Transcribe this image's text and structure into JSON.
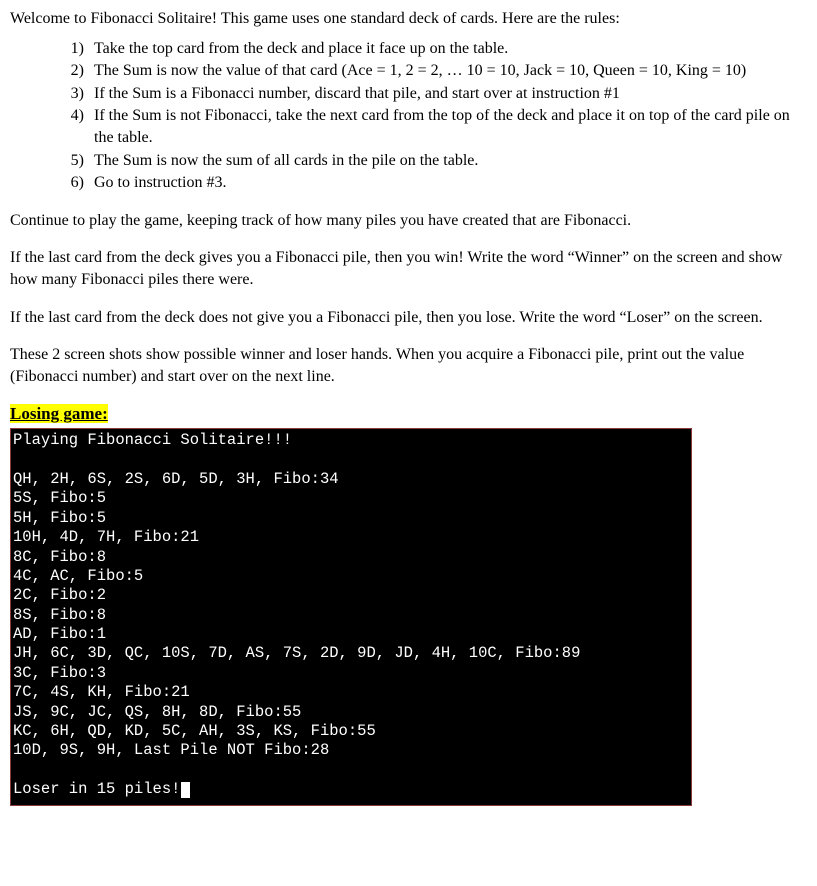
{
  "intro": "Welcome to Fibonacci Solitaire! This game uses one standard deck of cards. Here are the rules:",
  "rules": [
    {
      "n": "1)",
      "text": "Take the top card from the deck and place it face up on the table."
    },
    {
      "n": "2)",
      "text": "The Sum is now the value of that card (Ace = 1, 2 = 2, … 10 = 10, Jack = 10, Queen = 10, King = 10)"
    },
    {
      "n": "3)",
      "text": "If the Sum is a Fibonacci number, discard that pile, and start over at instruction #1"
    },
    {
      "n": "4)",
      "text": "If the Sum is not Fibonacci, take the next card from the top of the deck and place it on top of the card pile on the table."
    },
    {
      "n": "5)",
      "text": "The Sum is now the sum of all cards in the pile on the table."
    },
    {
      "n": "6)",
      "text": "Go to instruction #3."
    }
  ],
  "para1": "Continue to play the game, keeping track of how many piles you have created that are Fibonacci.",
  "para2": "If the last card from the deck gives you a Fibonacci pile, then you win! Write the word “Winner” on the screen and show how many Fibonacci piles there were.",
  "para3": "If the last card from the deck does not give you a Fibonacci pile, then you lose. Write the word “Loser” on the screen.",
  "para4": "These 2 screen shots show possible winner and loser hands. When you acquire a Fibonacci pile, print out the value (Fibonacci number) and start over on the next line.",
  "losing_label": "Losing game:",
  "terminal": {
    "header": "Playing Fibonacci Solitaire!!!",
    "blank1": "",
    "lines": [
      "QH, 2H, 6S, 2S, 6D, 5D, 3H, Fibo:34",
      "5S, Fibo:5",
      "5H, Fibo:5",
      "10H, 4D, 7H, Fibo:21",
      "8C, Fibo:8",
      "4C, AC, Fibo:5",
      "2C, Fibo:2",
      "8S, Fibo:8",
      "AD, Fibo:1",
      "JH, 6C, 3D, QC, 10S, 7D, AS, 7S, 2D, 9D, JD, 4H, 10C, Fibo:89",
      "3C, Fibo:3",
      "7C, 4S, KH, Fibo:21",
      "JS, 9C, JC, QS, 8H, 8D, Fibo:55",
      "KC, 6H, QD, KD, 5C, AH, 3S, KS, Fibo:55",
      "10D, 9S, 9H, Last Pile NOT Fibo:28"
    ],
    "blank2": "",
    "footer": "Loser in 15 piles!"
  }
}
